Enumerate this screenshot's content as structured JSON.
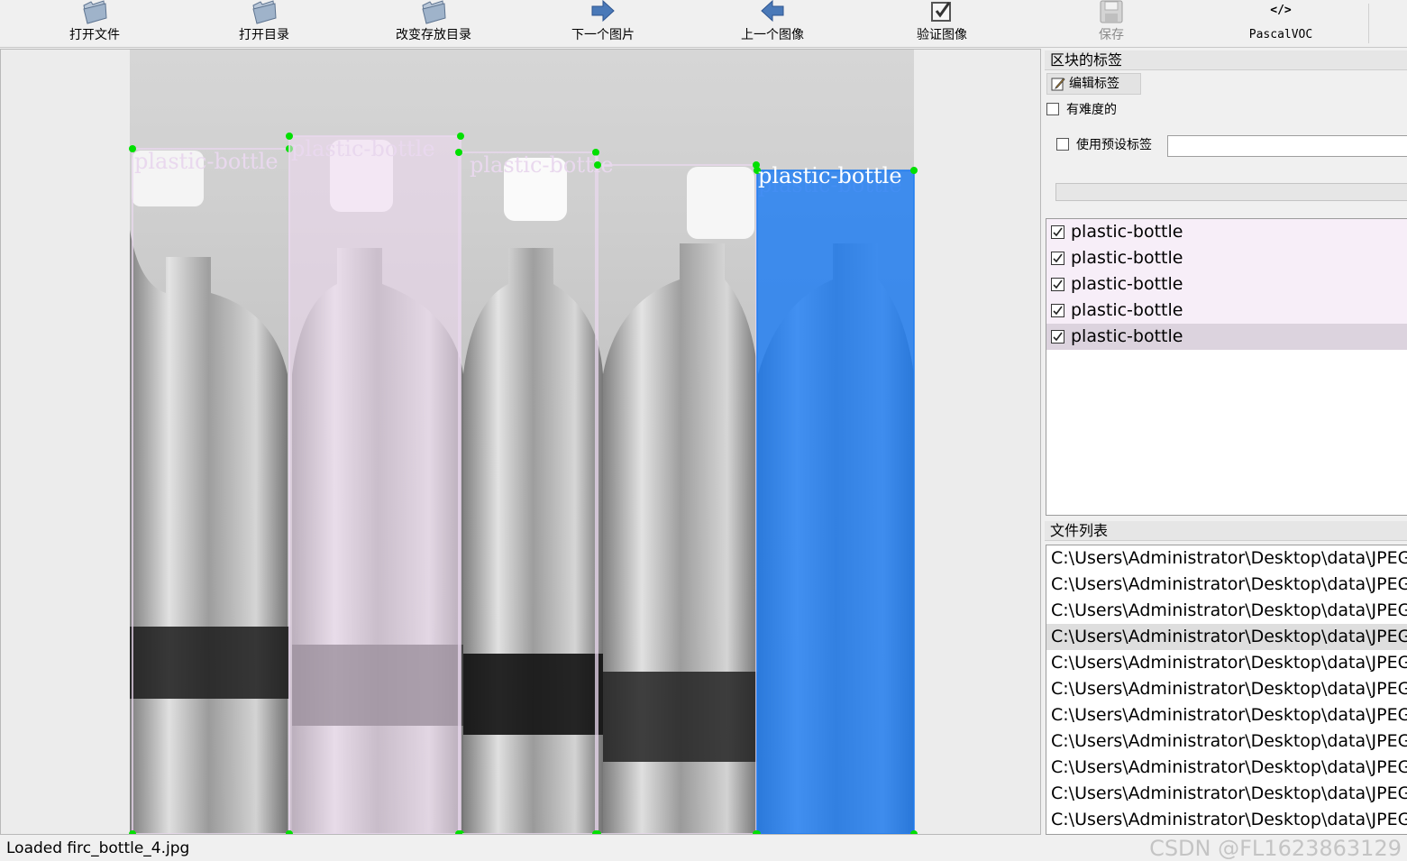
{
  "toolbar": {
    "open_file": "打开文件",
    "open_dir": "打开目录",
    "change_save_dir": "改变存放目录",
    "next_image": "下一个图片",
    "prev_image": "上一个图像",
    "verify_image": "验证图像",
    "save": "保存",
    "format": "PascalVOC",
    "format_icon": "</>"
  },
  "canvas": {
    "shapes": [
      {
        "label": "plastic-bottle",
        "fill": "none",
        "stroke": "#e9d8ee"
      },
      {
        "label": "plastic-bottle",
        "fill": "rgba(238,216,240,0.55)",
        "stroke": "#e9d8ee"
      },
      {
        "label": "plastic-bottle",
        "fill": "none",
        "stroke": "#e9d8ee"
      },
      {
        "label": "plastic-bottle",
        "fill": "none",
        "stroke": "#e9d8ee"
      },
      {
        "label": "plastic-bottle",
        "fill": "rgba(20,120,245,0.78)",
        "stroke": "#1e7cf0",
        "selected": true
      }
    ],
    "vertex_color": "#00e000"
  },
  "panel": {
    "box_labels_title": "区块的标签",
    "edit_label_button": "编辑标签",
    "difficult_checkbox": "有难度的",
    "use_default_label_checkbox": "使用预设标签",
    "default_label_value": "",
    "labels": [
      {
        "text": "plastic-bottle",
        "checked": true,
        "selected": false
      },
      {
        "text": "plastic-bottle",
        "checked": true,
        "selected": false
      },
      {
        "text": "plastic-bottle",
        "checked": true,
        "selected": false
      },
      {
        "text": "plastic-bottle",
        "checked": true,
        "selected": false
      },
      {
        "text": "plastic-bottle",
        "checked": true,
        "selected": true
      }
    ],
    "file_list_title": "文件列表",
    "files": [
      "C:\\Users\\Administrator\\Desktop\\data\\JPEG",
      "C:\\Users\\Administrator\\Desktop\\data\\JPEG",
      "C:\\Users\\Administrator\\Desktop\\data\\JPEG",
      "C:\\Users\\Administrator\\Desktop\\data\\JPEG",
      "C:\\Users\\Administrator\\Desktop\\data\\JPEG",
      "C:\\Users\\Administrator\\Desktop\\data\\JPEG",
      "C:\\Users\\Administrator\\Desktop\\data\\JPEG",
      "C:\\Users\\Administrator\\Desktop\\data\\JPEG",
      "C:\\Users\\Administrator\\Desktop\\data\\JPEG",
      "C:\\Users\\Administrator\\Desktop\\data\\JPEG",
      "C:\\Users\\Administrator\\Desktop\\data\\JPEG"
    ],
    "selected_file_index": 3
  },
  "status": {
    "message": "Loaded firc_bottle_4.jpg",
    "watermark": "CSDN @FL1623863129"
  },
  "colors": {
    "label_highlight": "#f7eef8",
    "label_selected": "#dcd3de",
    "file_selected": "#dedede"
  }
}
